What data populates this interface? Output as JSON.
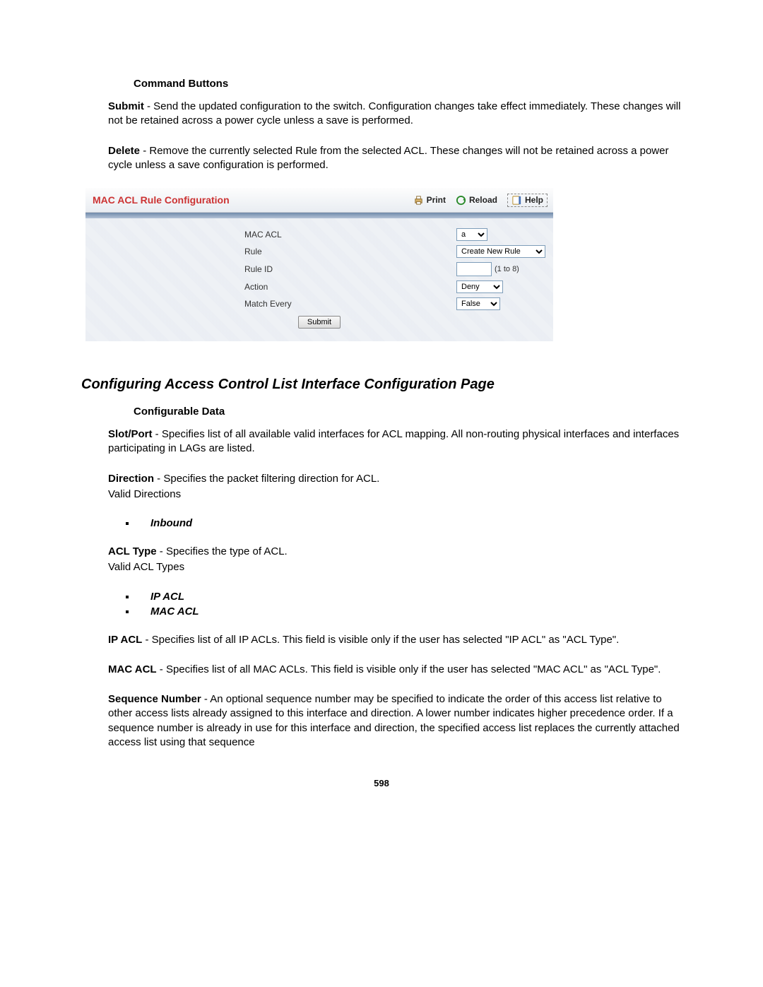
{
  "headings": {
    "command_buttons": "Command Buttons",
    "config_page": "Configuring Access Control List Interface Configuration Page",
    "configurable_data": "Configurable Data"
  },
  "command": {
    "submit_term": "Submit",
    "submit_text": " - Send the updated configuration to the switch. Configuration changes take effect immediately. These changes will not be retained across a power cycle unless a save is performed.",
    "delete_term": "Delete",
    "delete_text": " - Remove the currently selected Rule from the selected ACL. These changes will not be retained across a power cycle unless a save configuration is performed."
  },
  "panel": {
    "title": "MAC ACL Rule Configuration",
    "actions": {
      "print": "Print",
      "reload": "Reload",
      "help": "Help"
    },
    "fields": {
      "mac_acl": {
        "label": "MAC ACL",
        "value": "a"
      },
      "rule": {
        "label": "Rule",
        "value": "Create New Rule"
      },
      "rule_id": {
        "label": "Rule ID",
        "hint": "(1 to 8)",
        "value": ""
      },
      "action": {
        "label": "Action",
        "value": "Deny"
      },
      "match_every": {
        "label": "Match Every",
        "value": "False"
      }
    },
    "submit": "Submit"
  },
  "config": {
    "slot_port_term": "Slot/Port",
    "slot_port_text": " - Specifies list of all available valid interfaces for ACL mapping. All non-routing physical interfaces and interfaces participating in LAGs are listed.",
    "direction_term": "Direction",
    "direction_text": " - Specifies the packet filtering direction for ACL.",
    "valid_directions": "Valid Directions",
    "bullet_inbound": "Inbound",
    "acl_type_term": "ACL Type",
    "acl_type_text": " - Specifies the type of ACL.",
    "valid_acl_types": "Valid ACL Types",
    "bullet_ip_acl": "IP ACL",
    "bullet_mac_acl": "MAC ACL",
    "ip_acl_term": "IP ACL",
    "ip_acl_text": " - Specifies list of all IP ACLs. This field is visible only if the user has selected \"IP ACL\" as \"ACL Type\".",
    "mac_acl_term": "MAC ACL",
    "mac_acl_text": " - Specifies list of all MAC ACLs. This field is visible only if the user has selected \"MAC ACL\" as \"ACL Type\".",
    "seq_term": "Sequence Number",
    "seq_text": " - An optional sequence number may be specified to indicate the order of this access list relative to other access lists already assigned to this interface and direction. A lower number indicates higher precedence order. If a sequence number is already in use for this interface and direction, the specified access list replaces the currently attached access list using that sequence"
  },
  "page_number": "598"
}
